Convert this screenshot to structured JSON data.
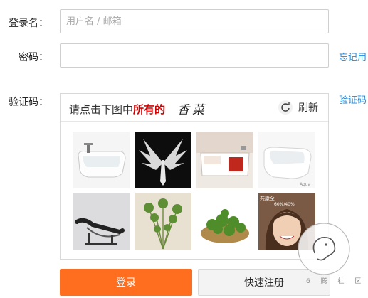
{
  "form": {
    "username_label": "登录名：",
    "username_placeholder": "用户名 / 邮箱",
    "password_label": "密码：",
    "forgot_password_link": "忘记用",
    "captcha_label": "验证码：",
    "captcha_help_link": "验证码"
  },
  "captcha": {
    "prompt_prefix": "请点击下图中",
    "prompt_highlight": "所有的",
    "target_word": "香菜",
    "refresh_label": "刷新",
    "tiles": [
      {
        "subject": "bathtub"
      },
      {
        "subject": "silver-wings-emblem"
      },
      {
        "subject": "bathtub"
      },
      {
        "subject": "bathtub"
      },
      {
        "subject": "lounge-chair"
      },
      {
        "subject": "coriander"
      },
      {
        "subject": "coriander"
      },
      {
        "subject": "woman-photo"
      }
    ],
    "tile_woman_caption": "共康全",
    "tile_woman_sub": "60%/40%"
  },
  "buttons": {
    "login_label": "登录",
    "register_label": "快速注册"
  },
  "watermark": {
    "text": "6 腾 社 区"
  },
  "colors": {
    "accent_orange": "#ff6d1f",
    "link_blue": "#1f86d8",
    "highlight_red": "#d40000"
  }
}
